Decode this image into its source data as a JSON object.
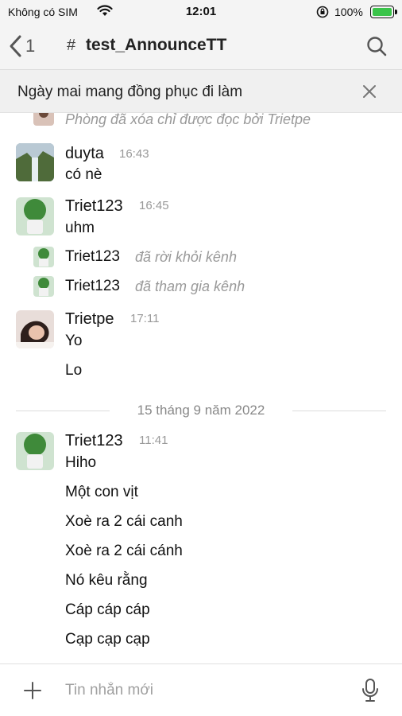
{
  "status_bar": {
    "carrier": "Không có SIM",
    "time": "12:01",
    "battery": "100%"
  },
  "header": {
    "back_count": "1",
    "channel_hash": "#",
    "channel_name": "test_AnnounceTT"
  },
  "announcement": {
    "text": "Ngày mai mang đồng phục đi làm"
  },
  "messages": {
    "partial_system": "Phòng đã xóa chỉ được đọc bởi Trietpe",
    "m1": {
      "user": "duyta",
      "time": "16:43",
      "text": "có nè"
    },
    "m2": {
      "user": "Triet123",
      "time": "16:45",
      "text": "uhm"
    },
    "sys1": {
      "user": "Triet123",
      "action": "đã rời khỏi kênh"
    },
    "sys2": {
      "user": "Triet123",
      "action": "đã tham gia kênh"
    },
    "m3": {
      "user": "Trietpe",
      "time": "17:11",
      "lines": [
        "Yo",
        "Lo"
      ]
    },
    "date_separator": "15 tháng 9 năm 2022",
    "m4": {
      "user": "Triet123",
      "time": "11:41",
      "lines": [
        "Hiho",
        "Một con vịt",
        "Xoè ra 2 cái canh",
        "Xoè ra 2 cái cánh",
        "Nó kêu rằng",
        "Cáp cáp cáp",
        "Cạp cạp cạp"
      ]
    }
  },
  "composer": {
    "placeholder": "Tin nhắn mới"
  },
  "colors": {
    "battery_fill": "#3ac44a",
    "header_bg": "#f4f4f4",
    "muted_text": "#999999"
  },
  "icons": [
    "wifi-icon",
    "lock-rotation-icon",
    "battery-icon",
    "back-chevron-icon",
    "search-icon",
    "close-icon",
    "plus-icon",
    "microphone-icon"
  ]
}
